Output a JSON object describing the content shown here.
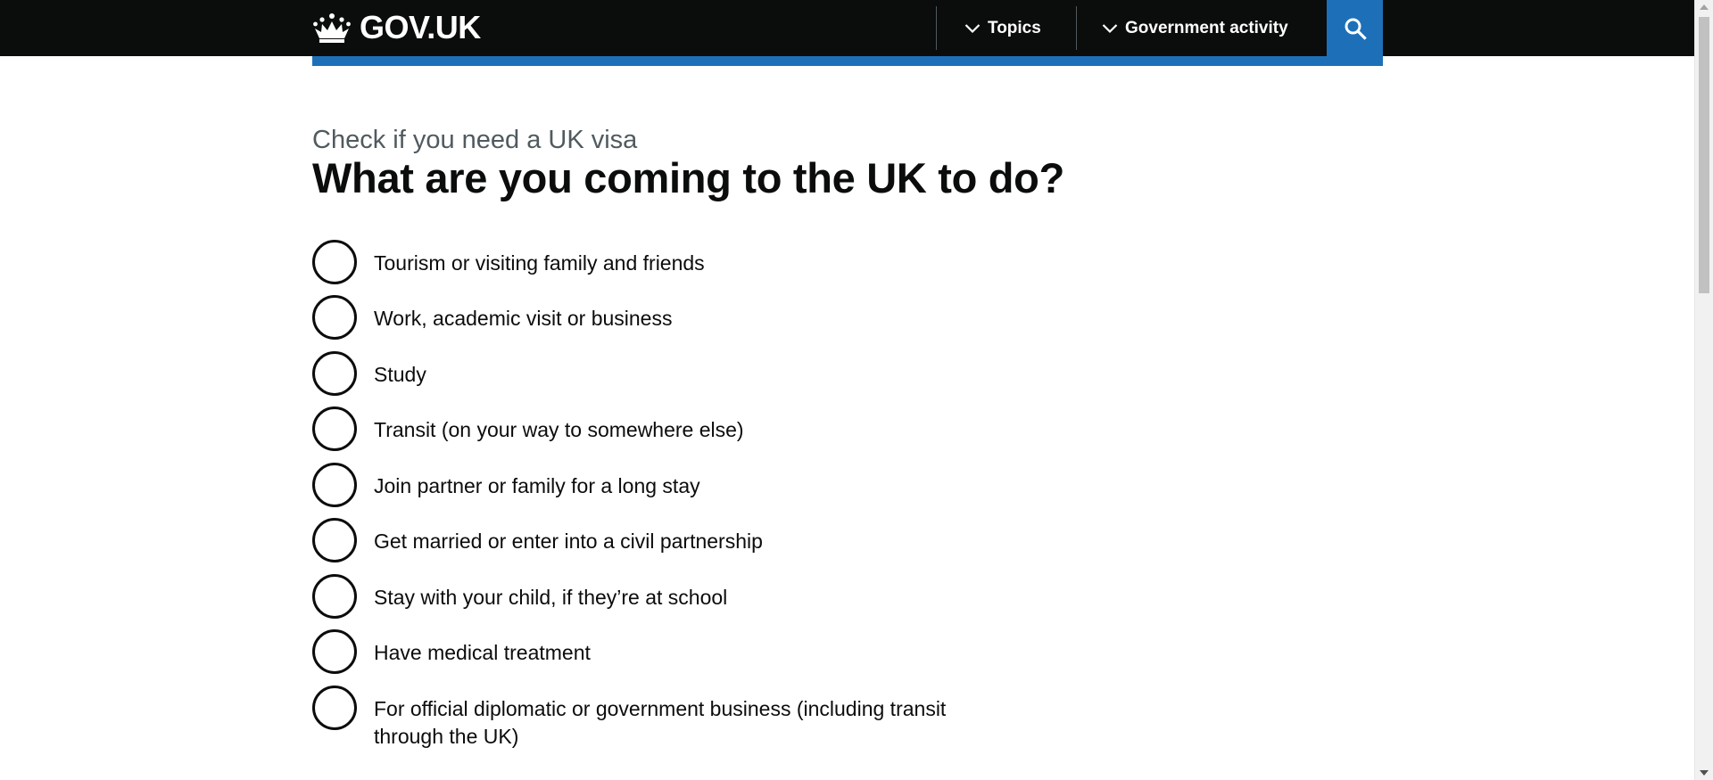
{
  "header": {
    "logo_text": "GOV.UK",
    "nav": [
      {
        "label": "Topics"
      },
      {
        "label": "Government activity"
      }
    ],
    "search_icon": "search-icon",
    "colors": {
      "header_bg": "#0b0c0c",
      "accent": "#1d70b8"
    }
  },
  "main": {
    "caption": "Check if you need a UK visa",
    "heading": "What are you coming to the UK to do?",
    "options": [
      {
        "label": "Tourism or visiting family and friends"
      },
      {
        "label": "Work, academic visit or business"
      },
      {
        "label": "Study"
      },
      {
        "label": "Transit (on your way to somewhere else)"
      },
      {
        "label": "Join partner or family for a long stay"
      },
      {
        "label": "Get married or enter into a civil partnership"
      },
      {
        "label": "Stay with your child, if they’re at school"
      },
      {
        "label": "Have medical treatment"
      },
      {
        "label": "For official diplomatic or government business (including transit through the UK)"
      }
    ]
  }
}
